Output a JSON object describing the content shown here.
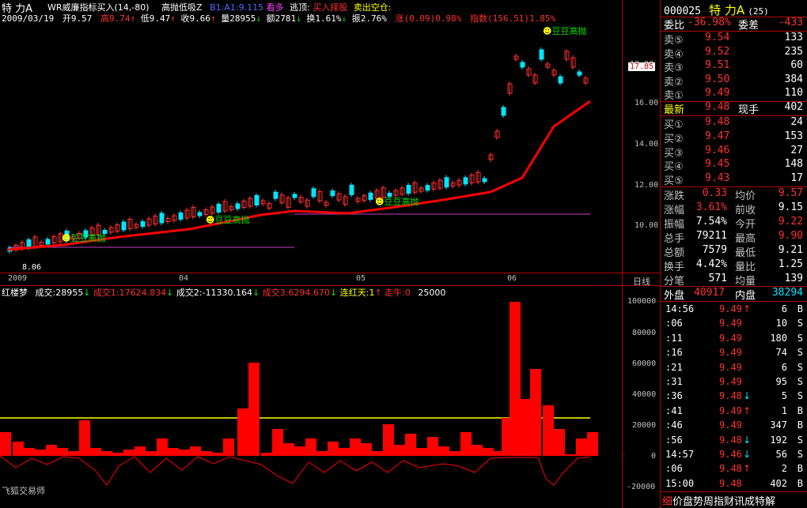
{
  "stock": {
    "code": "000025",
    "name": "特 力A",
    "window_num": "25",
    "short_name": "特  力A"
  },
  "quote_header": {
    "date": "2009/03/19",
    "open_label": "开",
    "open": "9.57",
    "high_label": "高",
    "high": "9.74",
    "low_label": "低",
    "low": "9.47",
    "close_label": "收",
    "close": "9.66",
    "volume_label": "量",
    "volume": "28955",
    "amount_label": "额",
    "amount": "2781",
    "turnover_label": "换",
    "turnover": "1.61%",
    "amplitude_label": "振",
    "amplitude": "2.76%",
    "change_text": "涨(0.09)0.98%",
    "index_text": "指数(156.51)1.85%"
  },
  "indicator_line": {
    "name": "WR威廉指标买入(14,-80)",
    "sub1": "高抛低吸Z",
    "b1": "B1:A1:9.115",
    "kanduo": "看多",
    "taopao": "逃顶:",
    "buy_select": "买入择股",
    "sell": "卖出空仓:"
  },
  "price_axis": {
    "ticks": [
      "18.00",
      "16.00",
      "14.00",
      "12.00",
      "10.00"
    ],
    "current": "17.85",
    "low_mark": "8.06"
  },
  "date_axis": {
    "labels": [
      "2009",
      "04",
      "05",
      "06"
    ],
    "period": "日线"
  },
  "signals": [
    "豆豆高抛",
    "豆豆高抛",
    "豆豆高抛",
    "豆豆高抛"
  ],
  "volume_panel": {
    "name": "红楼梦",
    "vol_label": "成交:",
    "vol_value": "28955",
    "vol1_label": "成交1:",
    "vol1_value": "17624.834",
    "vol2_label": "成交2:",
    "vol2_value": "-11330.164",
    "vol3_label": "成交3:",
    "vol3_value": "6294.670",
    "lianhong_label": "连红天:",
    "lianhong_value": "1",
    "zouniu_label": "走牛:",
    "zouniu_value": "0",
    "threshold": "25000",
    "axis": [
      "100000",
      "80000",
      "60000",
      "40000",
      "20000",
      "0",
      "-20000"
    ]
  },
  "footer_left": "飞狐交易师",
  "footer_right": "价盘势周指财讯成特解",
  "footer_right_mark": "细",
  "order_book": {
    "weibi_label": "委比",
    "weibi": "-36.98%",
    "weicha_label": "委差",
    "weicha": "-433",
    "asks": [
      {
        "label": "卖⑤",
        "price": "9.54",
        "vol": "133"
      },
      {
        "label": "卖④",
        "price": "9.52",
        "vol": "235"
      },
      {
        "label": "卖③",
        "price": "9.51",
        "vol": "60"
      },
      {
        "label": "卖②",
        "price": "9.50",
        "vol": "384"
      },
      {
        "label": "卖①",
        "price": "9.49",
        "vol": "110"
      }
    ],
    "latest_label": "最新",
    "latest": "9.48",
    "now_hand_label": "现手",
    "now_hand": "402",
    "bids": [
      {
        "label": "买①",
        "price": "9.48",
        "vol": "24"
      },
      {
        "label": "买②",
        "price": "9.47",
        "vol": "153"
      },
      {
        "label": "买③",
        "price": "9.46",
        "vol": "27"
      },
      {
        "label": "买④",
        "price": "9.45",
        "vol": "148"
      },
      {
        "label": "买⑤",
        "price": "9.43",
        "vol": "17"
      }
    ]
  },
  "stats": [
    {
      "l1": "涨跌",
      "v1": "0.33",
      "l2": "均价",
      "v2": "9.57"
    },
    {
      "l1": "涨幅",
      "v1": "3.61%",
      "l2": "前收",
      "v2": "9.15"
    },
    {
      "l1": "振幅",
      "v1": "7.54%",
      "l2": "今开",
      "v2": "9.22"
    },
    {
      "l1": "总手",
      "v1": "79211",
      "l2": "最高",
      "v2": "9.90"
    },
    {
      "l1": "总额",
      "v1": "7579",
      "l2": "最低",
      "v2": "9.21"
    },
    {
      "l1": "换手",
      "v1": "4.42%",
      "l2": "量比",
      "v2": "1.25"
    },
    {
      "l1": "分笔",
      "v1": "571",
      "l2": "均量",
      "v2": "139"
    }
  ],
  "outer_inner": {
    "wai_label": "外盘",
    "wai": "40917",
    "nei_label": "内盘",
    "nei": "38294"
  },
  "trades": [
    {
      "time": "14:56",
      "price": "9.49",
      "vol": "6",
      "side": "B",
      "dir": "up"
    },
    {
      "time": ":06",
      "price": "9.49",
      "vol": "10",
      "side": "S",
      "dir": ""
    },
    {
      "time": ":11",
      "price": "9.49",
      "vol": "180",
      "side": "S",
      "dir": ""
    },
    {
      "time": ":16",
      "price": "9.49",
      "vol": "74",
      "side": "S",
      "dir": ""
    },
    {
      "time": ":21",
      "price": "9.49",
      "vol": "6",
      "side": "S",
      "dir": ""
    },
    {
      "time": ":31",
      "price": "9.49",
      "vol": "95",
      "side": "S",
      "dir": ""
    },
    {
      "time": ":36",
      "price": "9.48",
      "vol": "5",
      "side": "S",
      "dir": "down"
    },
    {
      "time": ":41",
      "price": "9.49",
      "vol": "1",
      "side": "B",
      "dir": "up"
    },
    {
      "time": ":46",
      "price": "9.49",
      "vol": "347",
      "side": "B",
      "dir": ""
    },
    {
      "time": ":56",
      "price": "9.48",
      "vol": "192",
      "side": "S",
      "dir": "down"
    },
    {
      "time": "14:57",
      "price": "9.46",
      "vol": "56",
      "side": "S",
      "dir": "down"
    },
    {
      "time": ":06",
      "price": "9.48",
      "vol": "2",
      "side": "B",
      "dir": "up"
    },
    {
      "time": "15:00",
      "price": "9.48",
      "vol": "402",
      "side": "B",
      "dir": ""
    }
  ]
}
